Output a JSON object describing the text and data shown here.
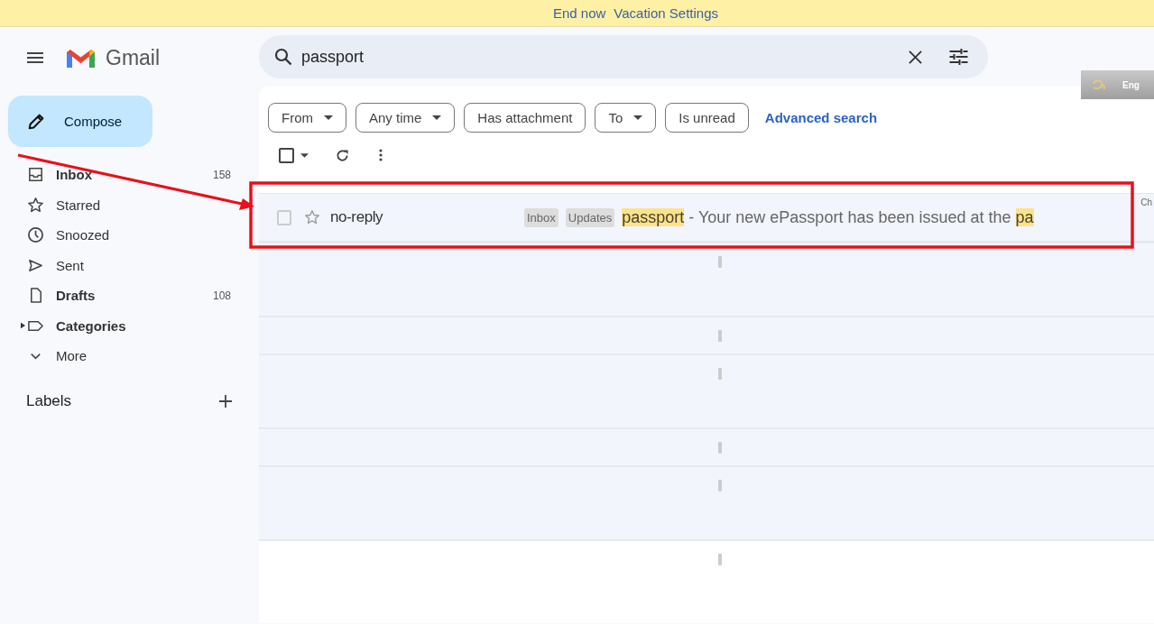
{
  "banner": {
    "links": [
      "End now",
      "Vacation Settings"
    ]
  },
  "app": {
    "name": "Gmail"
  },
  "search": {
    "value": "passport"
  },
  "compose": {
    "label": "Compose"
  },
  "sidebar": {
    "items": [
      {
        "label": "Inbox",
        "count": "158",
        "unread": true,
        "expandable": false
      },
      {
        "label": "Starred",
        "unread": false,
        "expandable": false
      },
      {
        "label": "Snoozed",
        "unread": false,
        "expandable": false
      },
      {
        "label": "Sent",
        "unread": false,
        "expandable": false
      },
      {
        "label": "Drafts",
        "count": "108",
        "unread": true,
        "expandable": false
      },
      {
        "label": "Categories",
        "unread": true,
        "expandable": true
      },
      {
        "label": "More",
        "unread": false,
        "expandable": false
      }
    ],
    "labels_heading": "Labels"
  },
  "filters": [
    {
      "label": "From",
      "dropdown": true
    },
    {
      "label": "Any time",
      "dropdown": true
    },
    {
      "label": "Has attachment",
      "dropdown": false
    },
    {
      "label": "To",
      "dropdown": true
    },
    {
      "label": "Is unread",
      "dropdown": false
    }
  ],
  "advanced_search": "Advanced search",
  "language_widget": {
    "label": "Eng"
  },
  "emails": [
    {
      "sender": "no-reply",
      "checked": false,
      "starred": false,
      "tags": [
        "Inbox",
        "Updates"
      ],
      "snippet": [
        {
          "text": "passport",
          "highlighted": true
        },
        {
          "text": " - Your new ePassport has been issued at the ",
          "highlighted": false
        },
        {
          "text": "pa",
          "highlighted": true
        }
      ],
      "trailing": "Ch"
    }
  ],
  "select_all": {
    "checked": false
  }
}
